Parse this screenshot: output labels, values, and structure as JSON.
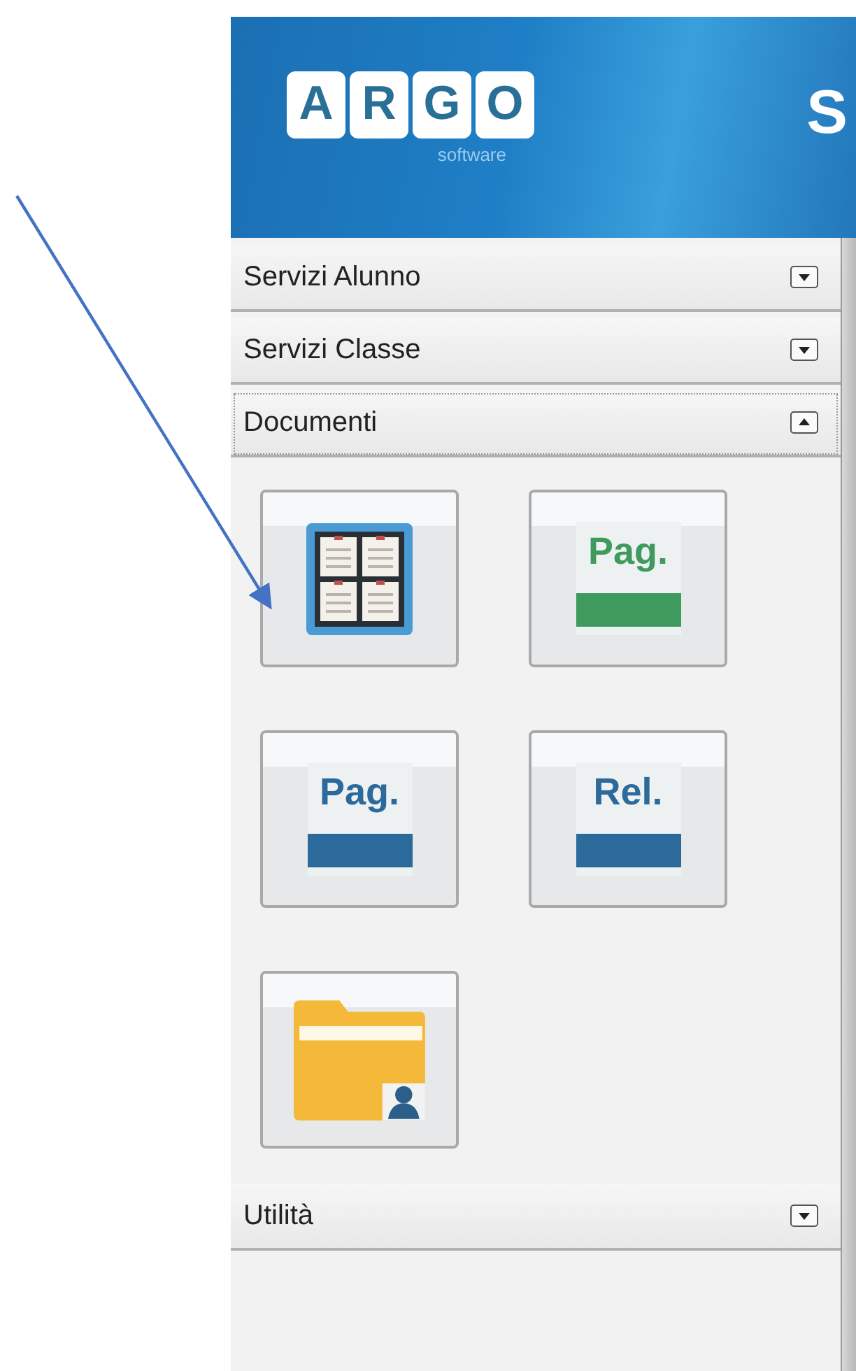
{
  "header": {
    "logo_letters": [
      "A",
      "R",
      "G",
      "O"
    ],
    "logo_subtitle": "software",
    "title": "S"
  },
  "sections": [
    {
      "title": "Servizi Alunno",
      "expanded": false,
      "selected": false
    },
    {
      "title": "Servizi Classe",
      "expanded": false,
      "selected": false
    },
    {
      "title": "Documenti",
      "expanded": true,
      "selected": true,
      "tiles": [
        {
          "kind": "grid"
        },
        {
          "kind": "label",
          "label": "Pag.",
          "color": "#3f9a5e"
        },
        {
          "kind": "label",
          "label": "Pag.",
          "color": "#2b6a9a"
        },
        {
          "kind": "label",
          "label": "Rel.",
          "color": "#2b6a9a"
        },
        {
          "kind": "folder"
        }
      ]
    },
    {
      "title": "Utilità",
      "expanded": false,
      "selected": false
    }
  ]
}
